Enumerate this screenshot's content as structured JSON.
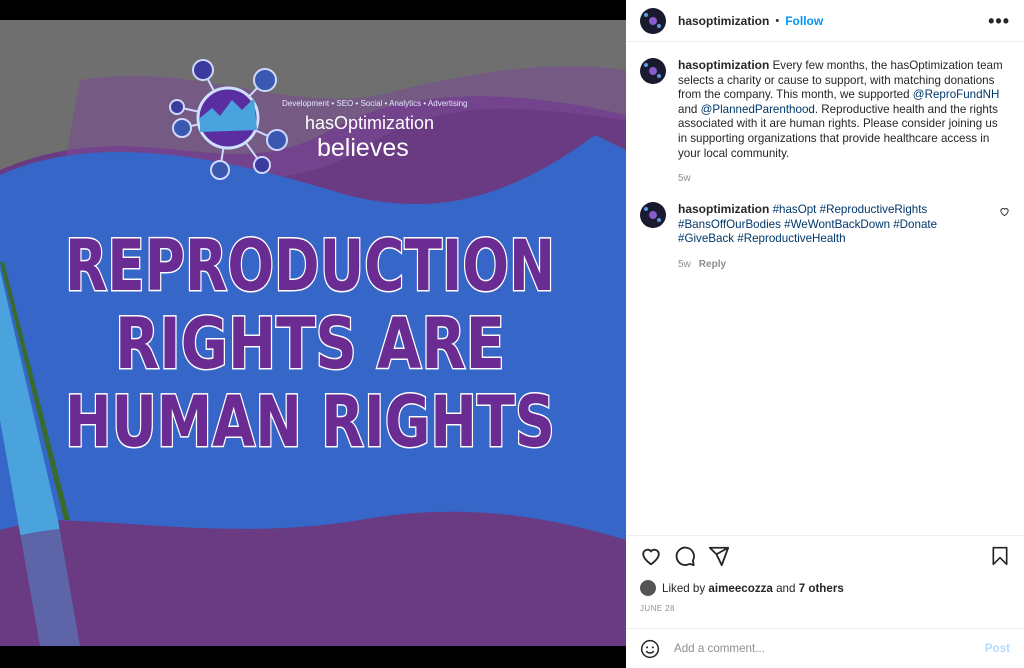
{
  "image": {
    "tagline": "Development • SEO • Social • Analytics • Advertising",
    "brand": "hasOptimization",
    "believes": "believes",
    "headline": [
      "REPRODUCTION",
      "RIGHTS ARE",
      "HUMAN RIGHTS"
    ],
    "colors": {
      "purple": "#6a3a83",
      "blue": "#3566c8",
      "grey": "#6f6f6f",
      "light_blue": "#4aa3dc",
      "green": "#3a6b2e"
    }
  },
  "header": {
    "username": "hasoptimization",
    "separator": "•",
    "follow_label": "Follow",
    "more_label": "•••"
  },
  "caption": {
    "username": "hasoptimization",
    "text_1": "Every few months, the hasOptimization team selects a charity or cause to support, with matching donations from the company. This month, we supported",
    "mention_1": "@ReproFundNH",
    "text_2": "and",
    "mention_2": "@PlannedParenthood",
    "text_3": ". Reproductive health and the rights associated with it are human rights. Please consider joining us in supporting organizations that provide healthcare access in your local community.",
    "time": "5w"
  },
  "comment": {
    "username": "hasoptimization",
    "hashtags": "#hasOpt #ReproductiveRights #BansOffOurBodies #WeWontBackDown #Donate #GiveBack #ReproductiveHealth",
    "time": "5w",
    "reply_label": "Reply"
  },
  "likes": {
    "prefix": "Liked by",
    "user": "aimeecozza",
    "and": "and",
    "others": "7 others"
  },
  "date": "JUNE 28",
  "add_comment": {
    "placeholder": "Add a comment...",
    "post_label": "Post"
  },
  "icons": [
    "heart-icon",
    "comment-icon",
    "share-icon",
    "bookmark-icon",
    "emoji-icon",
    "more-icon"
  ]
}
